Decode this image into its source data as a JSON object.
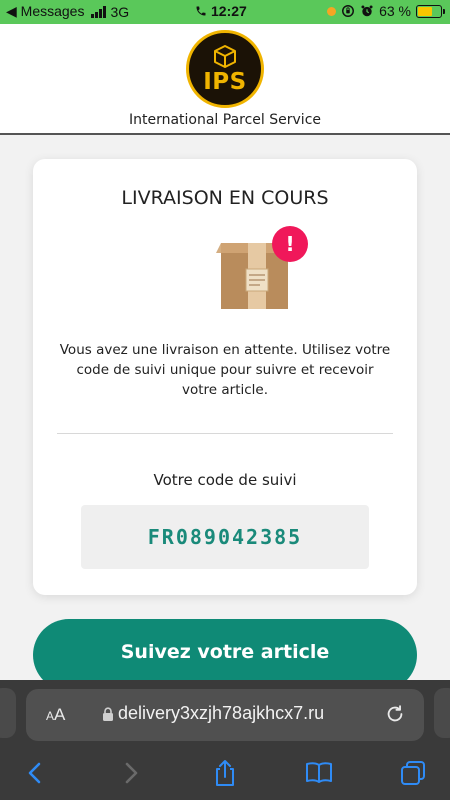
{
  "status_bar": {
    "back_label": "◀ Messages",
    "network": "3G",
    "time": "12:27",
    "battery_percent": "63 %",
    "battery_level": 0.63,
    "bar_color": "#5ac85a"
  },
  "header": {
    "logo_text": "IPS",
    "brand_name": "International Parcel Service",
    "logo_colors": {
      "ring": "#f0b400",
      "background": "#1b1206"
    }
  },
  "card": {
    "title": "LIVRAISON EN COURS",
    "badge": "!",
    "description": "Vous avez une livraison en attente. Utilisez votre code de suivi unique pour suivre et recevoir votre article.",
    "tracking_label": "Votre code de suivi",
    "tracking_code": "FR089042385",
    "accent_color": "#1a8a7a",
    "badge_color": "#f0185a"
  },
  "cta": {
    "label": "Suivez votre article",
    "color": "#0f8a76"
  },
  "browser": {
    "text_size_label_small": "A",
    "text_size_label_large": "A",
    "url": "delivery3xzjh78ajkhcx7.ru",
    "icons": [
      "lock-icon",
      "reload-icon",
      "back-icon",
      "forward-icon",
      "share-icon",
      "bookmarks-icon",
      "tabs-icon"
    ]
  }
}
